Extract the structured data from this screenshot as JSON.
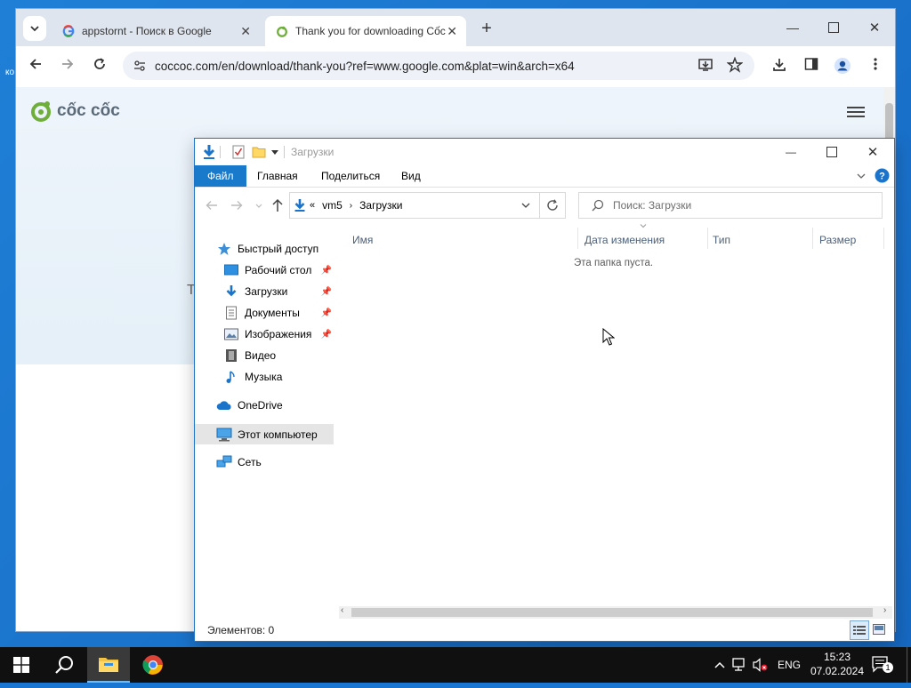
{
  "chrome": {
    "tabs": [
      {
        "title": "appstornt - Поиск в Google",
        "active": false
      },
      {
        "title": "Thank you for downloading Cốc",
        "active": true
      }
    ],
    "url": "coccoc.com/en/download/thank-you?ref=www.google.com&plat=win&arch=x64",
    "page": {
      "logo_text": "cốc cốc",
      "stray_char": "T"
    },
    "edge_text": "ко"
  },
  "explorer": {
    "title": "Загрузки",
    "ribbon": {
      "file": "Файл",
      "home": "Главная",
      "share": "Поделиться",
      "view": "Вид"
    },
    "address": {
      "root": "vm5",
      "current": "Загрузки",
      "chevrons": "«"
    },
    "search_placeholder": "Поиск: Загрузки",
    "nav": {
      "quick_access": "Быстрый доступ",
      "desktop": "Рабочий стол",
      "downloads": "Загрузки",
      "documents": "Документы",
      "pictures": "Изображения",
      "video": "Видео",
      "music": "Музыка",
      "onedrive": "OneDrive",
      "this_pc": "Этот компьютер",
      "network": "Сеть"
    },
    "columns": {
      "name": "Имя",
      "date": "Дата изменения",
      "type": "Тип",
      "size": "Размер"
    },
    "empty_message": "Эта папка пуста.",
    "status": "Элементов: 0"
  },
  "taskbar": {
    "language": "ENG",
    "time": "15:23",
    "date": "07.02.2024",
    "notification_count": "1"
  },
  "colors": {
    "accent": "#1979ca",
    "desktop": "#1668c1",
    "taskbar": "#101010",
    "coccoc_green": "#6fae3a"
  }
}
